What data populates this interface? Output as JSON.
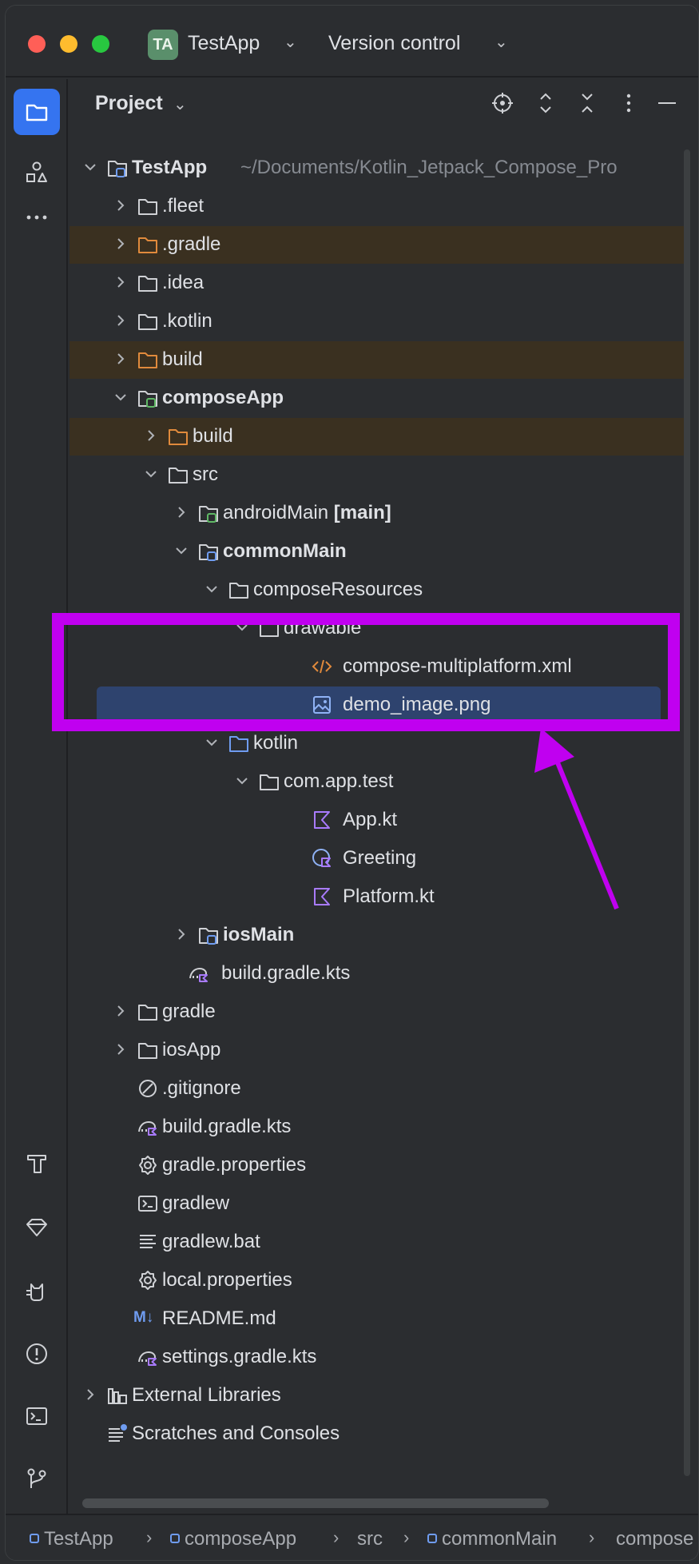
{
  "titlebar": {
    "project_badge": "TA",
    "project_name": "TestApp",
    "vcs_label": "Version control"
  },
  "panel": {
    "title": "Project"
  },
  "tree": {
    "root_name": "TestApp",
    "root_path": "~/Documents/Kotlin_Jetpack_Compose_Pro",
    "items": [
      {
        "label": ".fleet"
      },
      {
        "label": ".gradle"
      },
      {
        "label": ".idea"
      },
      {
        "label": ".kotlin"
      },
      {
        "label": "build"
      },
      {
        "label": "composeApp"
      },
      {
        "label": "build"
      },
      {
        "label": "src"
      },
      {
        "label": "androidMain",
        "tag": "[main]"
      },
      {
        "label": "commonMain"
      },
      {
        "label": "composeResources"
      },
      {
        "label": "drawable"
      },
      {
        "label": "compose-multiplatform.xml"
      },
      {
        "label": "demo_image.png"
      },
      {
        "label": "kotlin"
      },
      {
        "label": "com.app.test"
      },
      {
        "label": "App.kt"
      },
      {
        "label": "Greeting"
      },
      {
        "label": "Platform.kt"
      },
      {
        "label": "iosMain"
      },
      {
        "label": "build.gradle.kts"
      },
      {
        "label": "gradle"
      },
      {
        "label": "iosApp"
      },
      {
        "label": ".gitignore"
      },
      {
        "label": "build.gradle.kts"
      },
      {
        "label": "gradle.properties"
      },
      {
        "label": "gradlew"
      },
      {
        "label": "gradlew.bat"
      },
      {
        "label": "local.properties"
      },
      {
        "label": "README.md"
      },
      {
        "label": "settings.gradle.kts"
      },
      {
        "label": "External Libraries"
      },
      {
        "label": "Scratches and Consoles"
      }
    ]
  },
  "breadcrumb": [
    "TestApp",
    "composeApp",
    "src",
    "commonMain",
    "compose"
  ],
  "icons": {
    "left_strip": [
      "folder-icon",
      "structure-icon",
      "more-icon",
      "build-hammer-icon",
      "gem-icon",
      "cat-icon",
      "problems-icon",
      "terminal-icon",
      "git-icon"
    ],
    "header": [
      "locate-icon",
      "expand-all-icon",
      "collapse-all-icon",
      "options-icon",
      "hide-icon"
    ]
  },
  "colors": {
    "accent": "#3574f0",
    "annotation": "#c000f0",
    "excluded_bg": "#3a3020",
    "selected_bg": "#2e436e",
    "kotlin": "#a97bff",
    "xml": "#e08a3c"
  }
}
